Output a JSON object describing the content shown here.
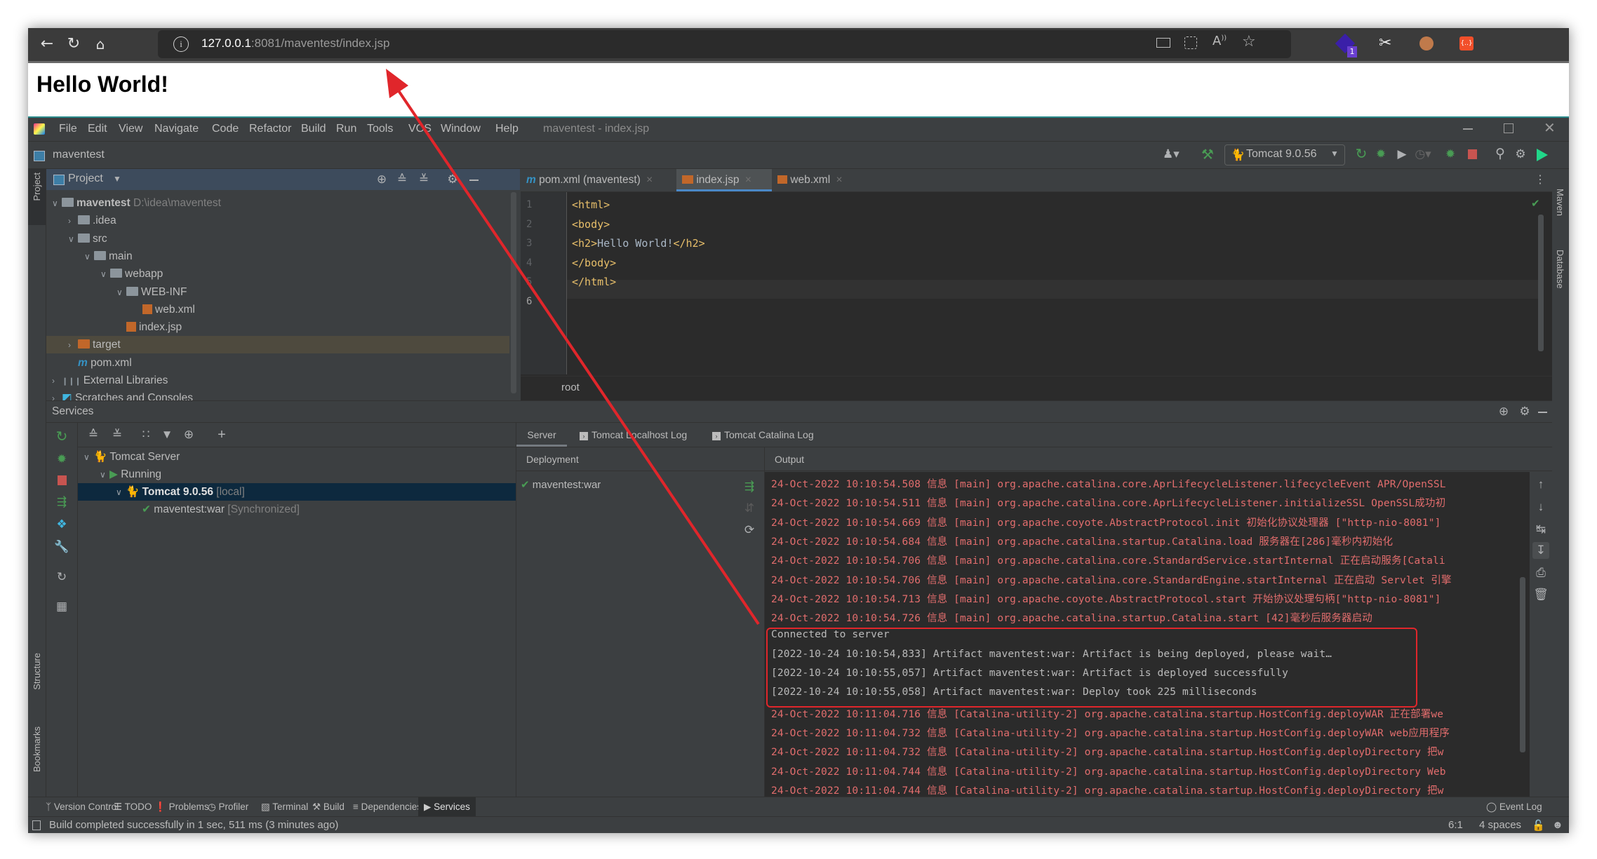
{
  "browser": {
    "url_host": "127.0.0.1",
    "url_rest": ":8081/maventest/index.jsp",
    "icons": [
      "back-icon",
      "refresh-icon",
      "home-icon",
      "site-info-icon",
      "app-available-icon",
      "split-screen-icon",
      "read-aloud-icon",
      "add-favorite-icon",
      "extension-icon",
      "screenshot-icon",
      "cookie-icon",
      "json-extension-icon"
    ],
    "extension_badge": "1",
    "json_ext_label": "{..}",
    "page_heading": "Hello World!"
  },
  "ide": {
    "menu": [
      "File",
      "Edit",
      "View",
      "Navigate",
      "Code",
      "Refactor",
      "Build",
      "Run",
      "Tools",
      "VCS",
      "Window",
      "Help"
    ],
    "window_title": "maventest - index.jsp",
    "project_name": "maventest",
    "run_config": "Tomcat 9.0.56",
    "project_panel": {
      "title": "Project",
      "tree": [
        {
          "label": "maventest",
          "hint": "D:\\idea\\maventest",
          "depth": 0,
          "expanded": true,
          "type": "module",
          "bold": true
        },
        {
          "label": ".idea",
          "depth": 1,
          "expanded": false,
          "type": "folder"
        },
        {
          "label": "src",
          "depth": 1,
          "expanded": true,
          "type": "folder"
        },
        {
          "label": "main",
          "depth": 2,
          "expanded": true,
          "type": "folder"
        },
        {
          "label": "webapp",
          "depth": 3,
          "expanded": true,
          "type": "web-folder"
        },
        {
          "label": "WEB-INF",
          "depth": 4,
          "expanded": true,
          "type": "folder"
        },
        {
          "label": "web.xml",
          "depth": 5,
          "type": "xml-file"
        },
        {
          "label": "index.jsp",
          "depth": 4,
          "type": "jsp-file"
        },
        {
          "label": "target",
          "depth": 1,
          "expanded": false,
          "type": "orange-folder",
          "selected": true
        },
        {
          "label": "pom.xml",
          "depth": 1,
          "type": "maven-file"
        },
        {
          "label": "External Libraries",
          "depth": 0,
          "expanded": false,
          "type": "libraries"
        },
        {
          "label": "Scratches and Consoles",
          "depth": 0,
          "expanded": false,
          "type": "scratches"
        }
      ]
    },
    "editor": {
      "tabs": [
        {
          "label": "pom.xml (maventest)",
          "icon": "maven-icon",
          "active": false
        },
        {
          "label": "index.jsp",
          "icon": "jsp-icon",
          "active": true
        },
        {
          "label": "web.xml",
          "icon": "xml-icon",
          "active": false
        }
      ],
      "lines": [
        {
          "n": "1",
          "tag": "<html>",
          "text": ""
        },
        {
          "n": "2",
          "tag": "<body>",
          "text": ""
        },
        {
          "n": "3",
          "tag": "<h2>",
          "text": "Hello World!",
          "close": "</h2>"
        },
        {
          "n": "4",
          "tag": "</body>",
          "text": ""
        },
        {
          "n": "5",
          "tag": "</html>",
          "text": ""
        },
        {
          "n": "6",
          "tag": "",
          "text": ""
        }
      ],
      "breadcrumb": "root"
    },
    "left_stripe": [
      "Project",
      "Structure",
      "Bookmarks"
    ],
    "right_stripe": [
      "Maven",
      "Database"
    ],
    "services": {
      "title": "Services",
      "tree": [
        {
          "label": "Tomcat Server",
          "depth": 0
        },
        {
          "label": "Running",
          "depth": 1
        },
        {
          "label": "Tomcat 9.0.56",
          "suffix": "[local]",
          "depth": 2,
          "selected": true
        },
        {
          "label": "maventest:war",
          "suffix": "[Synchronized]",
          "depth": 3
        }
      ],
      "tabs": [
        "Server",
        "Tomcat Localhost Log",
        "Tomcat Catalina Log"
      ],
      "deployment_header": "Deployment",
      "deployment_item": "maventest:war",
      "output_header": "Output",
      "log": [
        {
          "text": "24-Oct-2022 10:10:54.508 信息 [main] org.apache.catalina.core.AprLifecycleListener.lifecycleEvent APR/OpenSSL",
          "kind": "err"
        },
        {
          "text": "24-Oct-2022 10:10:54.511 信息 [main] org.apache.catalina.core.AprLifecycleListener.initializeSSL OpenSSL成功初",
          "kind": "err"
        },
        {
          "text": "24-Oct-2022 10:10:54.669 信息 [main] org.apache.coyote.AbstractProtocol.init 初始化协议处理器 [\"http-nio-8081\"]",
          "kind": "err"
        },
        {
          "text": "24-Oct-2022 10:10:54.684 信息 [main] org.apache.catalina.startup.Catalina.load 服务器在[286]毫秒内初始化",
          "kind": "err"
        },
        {
          "text": "24-Oct-2022 10:10:54.706 信息 [main] org.apache.catalina.core.StandardService.startInternal 正在启动服务[Catali",
          "kind": "err"
        },
        {
          "text": "24-Oct-2022 10:10:54.706 信息 [main] org.apache.catalina.core.StandardEngine.startInternal 正在启动 Servlet 引擎",
          "kind": "err"
        },
        {
          "text": "24-Oct-2022 10:10:54.713 信息 [main] org.apache.coyote.AbstractProtocol.start 开始协议处理句柄[\"http-nio-8081\"]",
          "kind": "err"
        },
        {
          "text": "24-Oct-2022 10:10:54.726 信息 [main] org.apache.catalina.startup.Catalina.start [42]毫秒后服务器启动",
          "kind": "err"
        },
        {
          "text": "Connected to server",
          "kind": "plain"
        },
        {
          "text": "[2022-10-24 10:10:54,833] Artifact maventest:war: Artifact is being deployed, please wait…",
          "kind": "plain"
        },
        {
          "text": "[2022-10-24 10:10:55,057] Artifact maventest:war: Artifact is deployed successfully",
          "kind": "plain"
        },
        {
          "text": "[2022-10-24 10:10:55,058] Artifact maventest:war: Deploy took 225 milliseconds",
          "kind": "plain"
        },
        {
          "text": "24-Oct-2022 10:11:04.716 信息 [Catalina-utility-2] org.apache.catalina.startup.HostConfig.deployWAR 正在部署we",
          "kind": "err"
        },
        {
          "text": "24-Oct-2022 10:11:04.732 信息 [Catalina-utility-2] org.apache.catalina.startup.HostConfig.deployWAR web应用程序",
          "kind": "err"
        },
        {
          "text": "24-Oct-2022 10:11:04.732 信息 [Catalina-utility-2] org.apache.catalina.startup.HostConfig.deployDirectory 把w",
          "kind": "err"
        },
        {
          "text": "24-Oct-2022 10:11:04.744 信息 [Catalina-utility-2] org.apache.catalina.startup.HostConfig.deployDirectory Web",
          "kind": "err"
        },
        {
          "text": "24-Oct-2022 10:11:04.744 信息 [Catalina-utility-2] org.apache.catalina.startup.HostConfig.deployDirectory 把w",
          "kind": "err"
        }
      ]
    },
    "bottom_tools": [
      "Version Control",
      "TODO",
      "Problems",
      "Profiler",
      "Terminal",
      "Build",
      "Dependencies",
      "Services"
    ],
    "active_bottom_tool": "Services",
    "event_log": "Event Log",
    "status": {
      "message": "Build completed successfully in 1 sec, 511 ms (3 minutes ago)",
      "position": "6:1",
      "indent": "4 spaces"
    }
  },
  "annotation": {
    "color": "#e0262b"
  }
}
